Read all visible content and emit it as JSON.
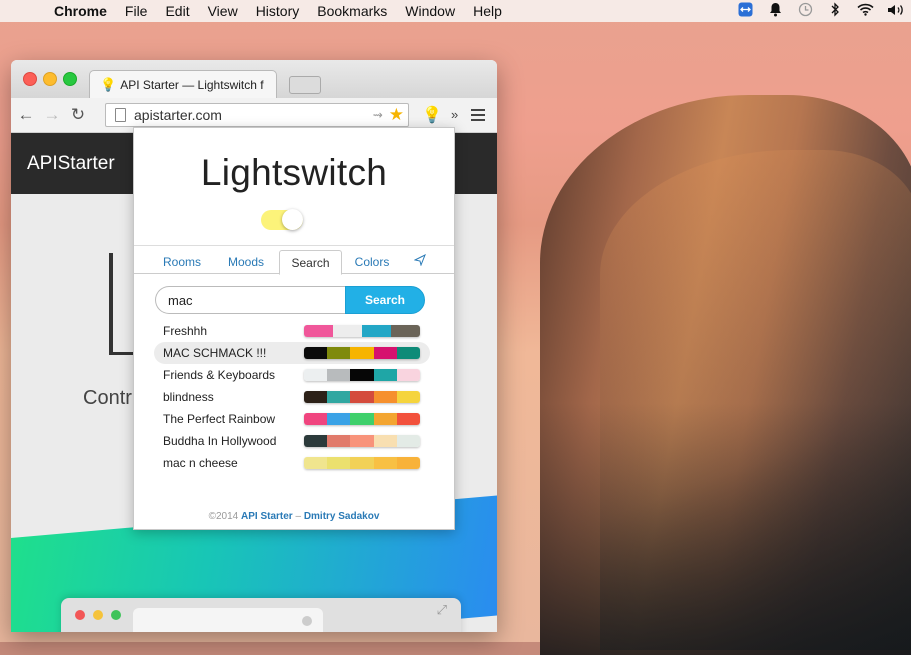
{
  "menubar": {
    "app_name": "Chrome",
    "items": [
      "File",
      "Edit",
      "View",
      "History",
      "Bookmarks",
      "Window",
      "Help"
    ]
  },
  "browser": {
    "tab_title": "API Starter — Lightswitch f",
    "url": "apistarter.com",
    "site_name": "APIStarter",
    "page_text": "Contr"
  },
  "popup": {
    "title": "Lightswitch",
    "toggle_on": true,
    "tabs": [
      {
        "label": "Rooms",
        "active": false
      },
      {
        "label": "Moods",
        "active": false
      },
      {
        "label": "Search",
        "active": true
      },
      {
        "label": "Colors",
        "active": false
      }
    ],
    "search": {
      "value": "mac",
      "button_label": "Search"
    },
    "results": [
      {
        "name": "Freshhh",
        "colors": [
          "#f0579a",
          "#ededed",
          "#23a7c6",
          "#6b6458"
        ]
      },
      {
        "name": "MAC SCHMACK !!!",
        "colors": [
          "#0b0b0b",
          "#7f8a0c",
          "#f6b400",
          "#d6126f",
          "#0e8b78"
        ]
      },
      {
        "name": "Friends & Keyboards",
        "colors": [
          "#eceff0",
          "#b8bbbd",
          "#060606",
          "#1fa6a6",
          "#f9d4df"
        ]
      },
      {
        "name": "blindness",
        "colors": [
          "#2c2118",
          "#31a7a1",
          "#d44b3c",
          "#f6902d",
          "#f5d43d"
        ]
      },
      {
        "name": "The Perfect Rainbow",
        "colors": [
          "#f0457f",
          "#3aa2e6",
          "#3fd06c",
          "#f3a531",
          "#f2513c"
        ]
      },
      {
        "name": "Buddha In Hollywood",
        "colors": [
          "#2c3a3b",
          "#e17a6b",
          "#f8937a",
          "#f8dfb1",
          "#e3ebe6"
        ]
      },
      {
        "name": "mac n cheese",
        "colors": [
          "#f0e58e",
          "#ebe06e",
          "#f2d157",
          "#f8c044",
          "#f8b23a"
        ]
      }
    ],
    "selected_index": 1,
    "footer": {
      "year": "©2014",
      "link1": "API Starter",
      "dash": "–",
      "link2": "Dmitry Sadakov"
    }
  }
}
